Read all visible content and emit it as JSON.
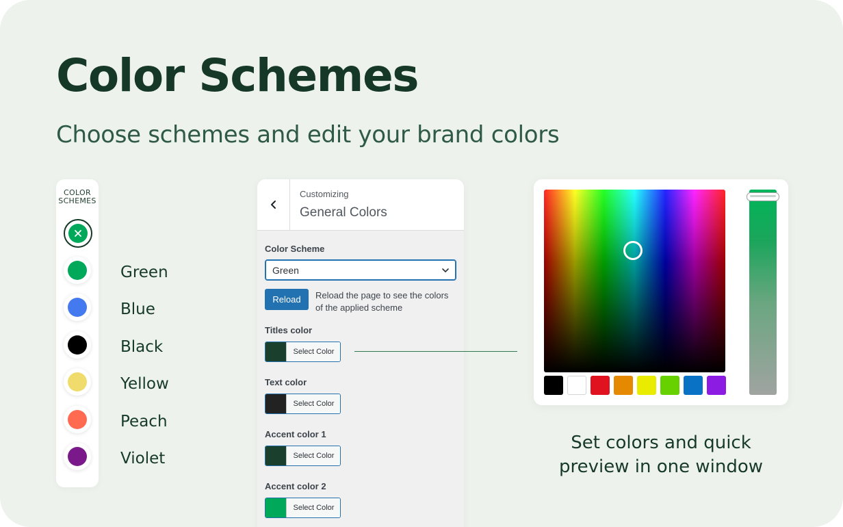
{
  "hero": {
    "title": "Color Schemes",
    "subtitle": "Choose schemes and edit your brand colors"
  },
  "scheme_panel": {
    "title": "COLOR\nSCHEMES",
    "reset_icon": "close-icon",
    "selected_reset_color": "#00a85a",
    "schemes": [
      {
        "name": "Green",
        "color": "#00a85a"
      },
      {
        "name": "Blue",
        "color": "#4479ef"
      },
      {
        "name": "Black",
        "color": "#000000"
      },
      {
        "name": "Yellow",
        "color": "#f0dc6c"
      },
      {
        "name": "Peach",
        "color": "#ff6a50"
      },
      {
        "name": "Violet",
        "color": "#7a198a"
      }
    ]
  },
  "customizer": {
    "breadcrumb": "Customizing",
    "section_title": "General Colors",
    "back_icon": "chevron-left-icon",
    "color_scheme_label": "Color Scheme",
    "color_scheme_value": "Green",
    "reload_label": "Reload",
    "reload_note": "Reload the page to see the colors of the applied scheme",
    "color_fields": [
      {
        "label": "Titles color",
        "button": "Select Color",
        "color": "#1b3f2d"
      },
      {
        "label": "Text color",
        "button": "Select Color",
        "color": "#222222"
      },
      {
        "label": "Accent color 1",
        "button": "Select Color",
        "color": "#1b3f2d"
      },
      {
        "label": "Accent color 2",
        "button": "Select Color",
        "color": "#00a85a"
      }
    ]
  },
  "picker": {
    "palette": [
      "#000000",
      "#ffffff",
      "#e0121f",
      "#e58a00",
      "#eaec00",
      "#67d100",
      "#0a72c4",
      "#8c1ce2"
    ],
    "strip_top_color": "#00b65a"
  },
  "caption": "Set colors and quick preview in one window"
}
